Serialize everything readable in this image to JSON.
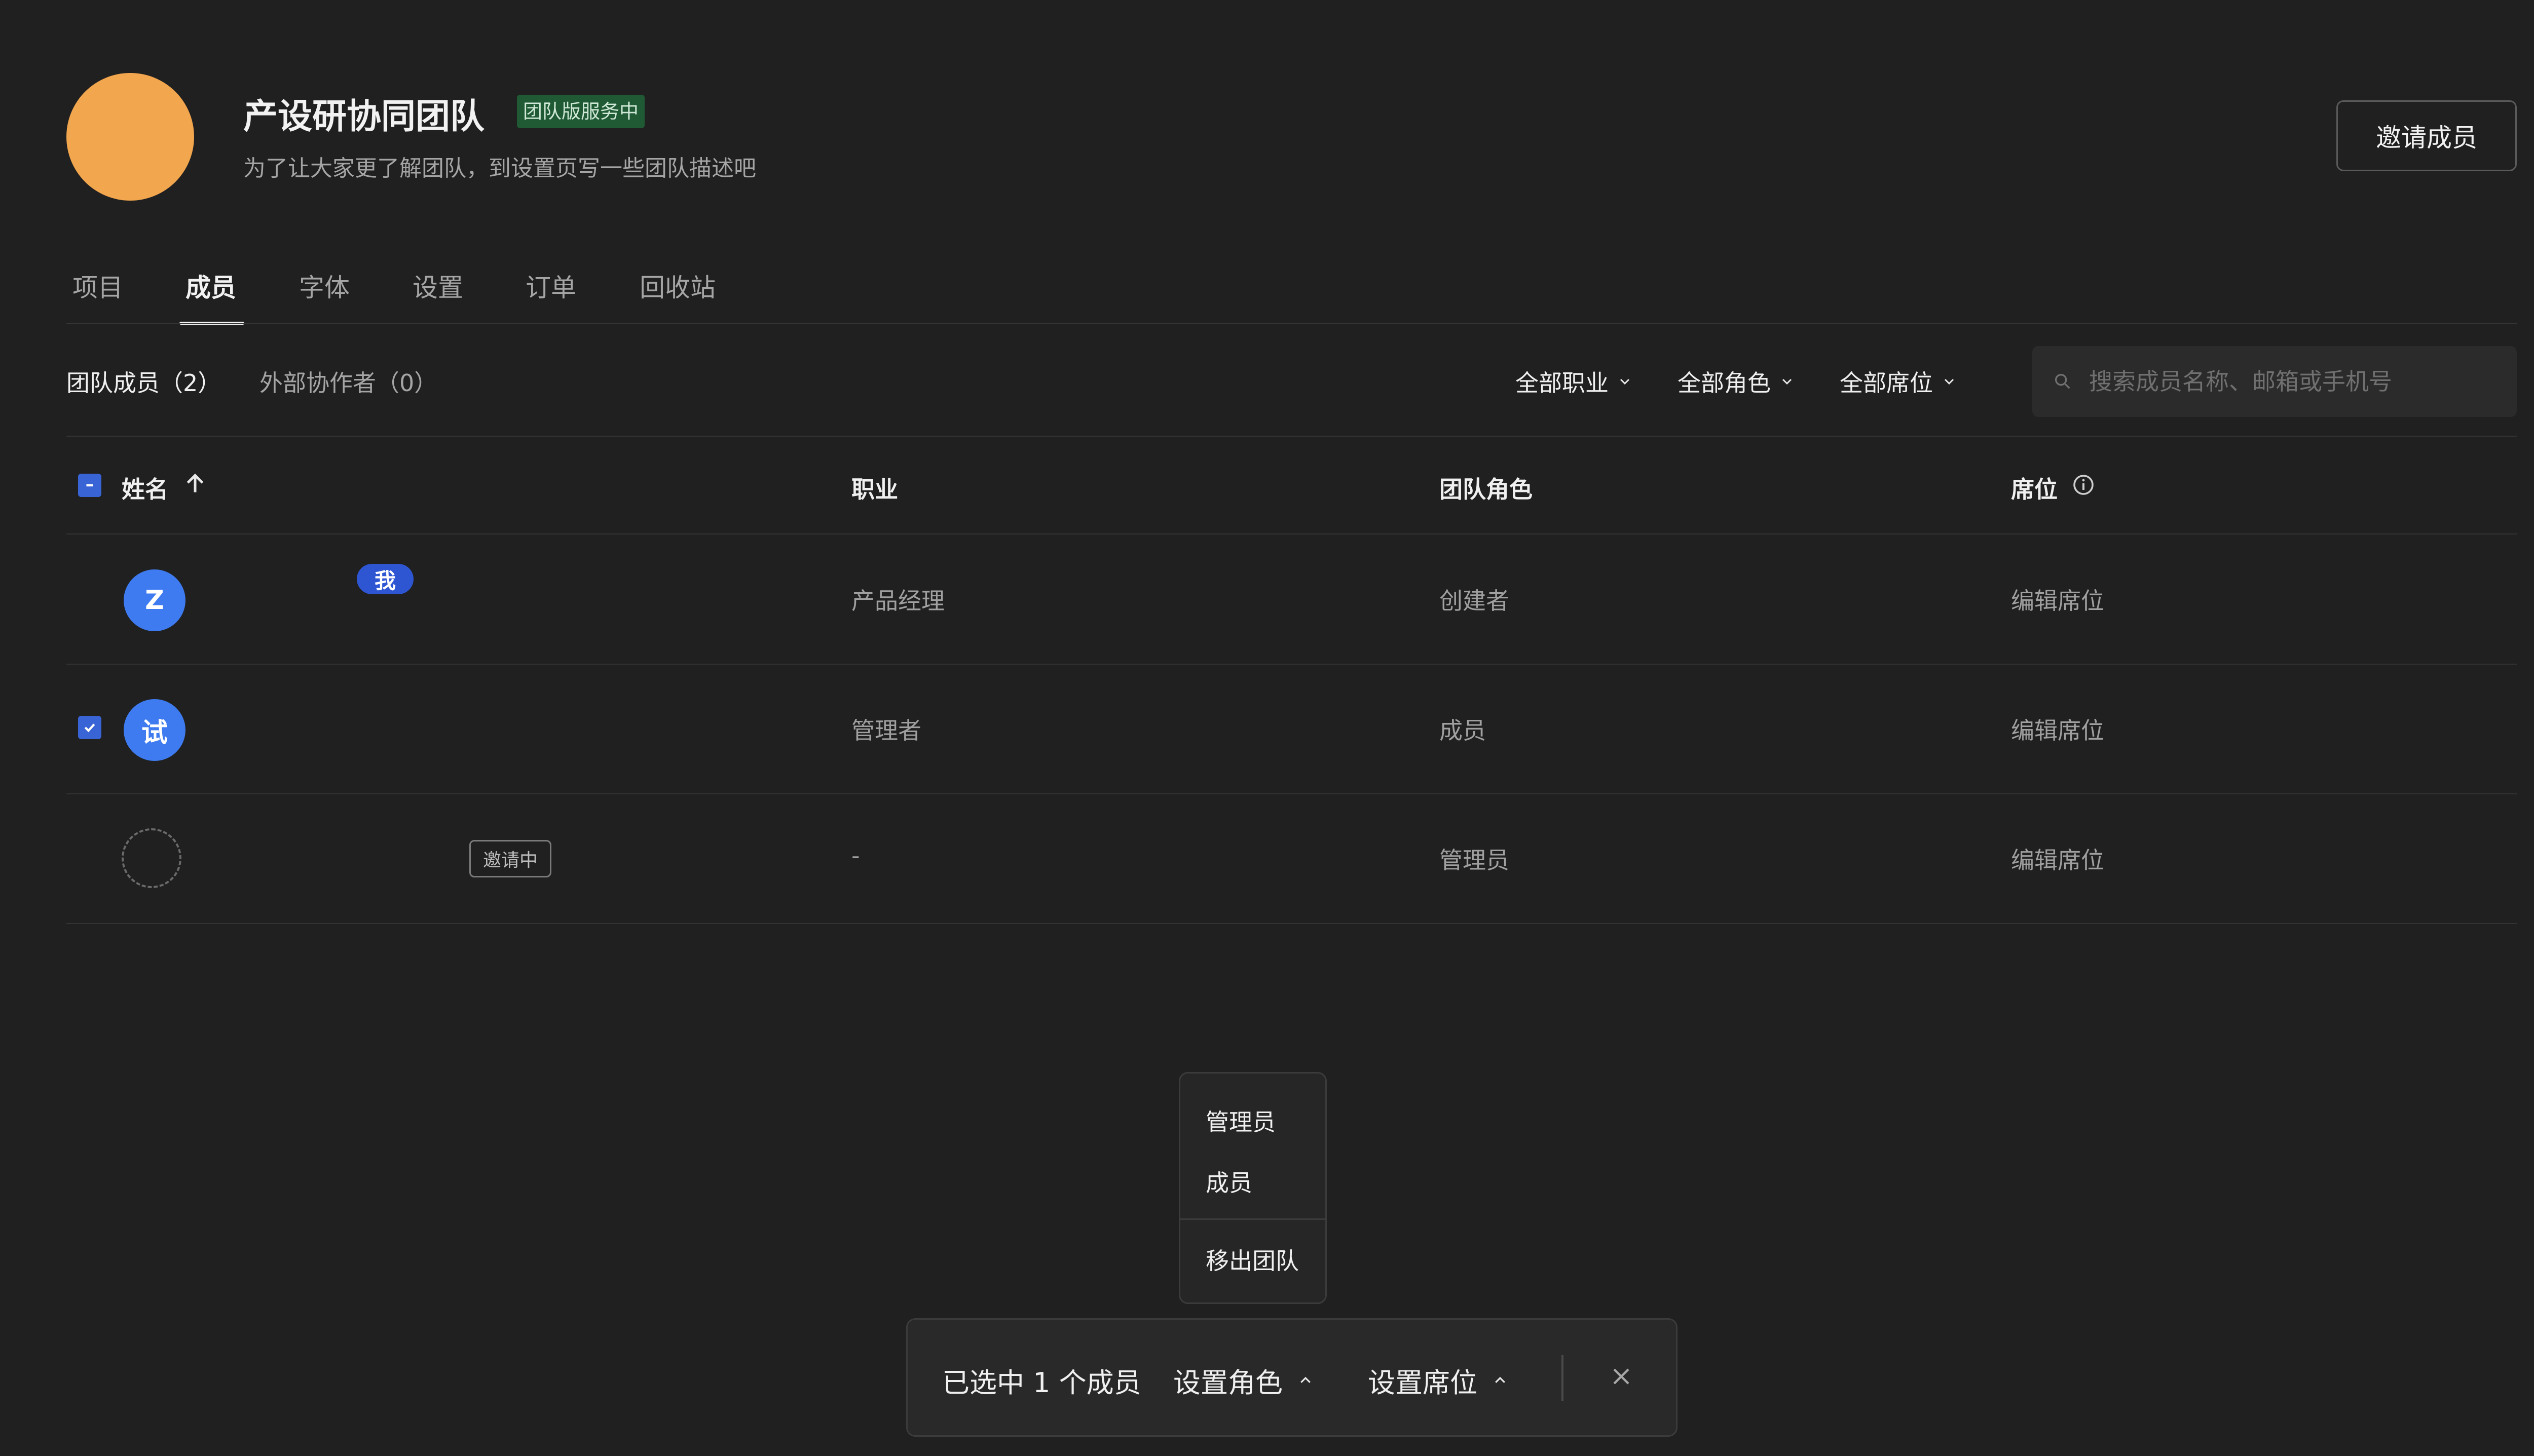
{
  "team": {
    "name": "产设研协同团队",
    "service_badge": "团队版服务中",
    "description": "为了让大家更了解团队，到设置页写一些团队描述吧",
    "invite_button": "邀请成员"
  },
  "tabs": [
    {
      "label": "项目",
      "active": false
    },
    {
      "label": "成员",
      "active": true
    },
    {
      "label": "字体",
      "active": false
    },
    {
      "label": "设置",
      "active": false
    },
    {
      "label": "订单",
      "active": false
    },
    {
      "label": "回收站",
      "active": false
    }
  ],
  "subtabs": {
    "members": "团队成员（2）",
    "external": "外部协作者（0）"
  },
  "filters": {
    "profession": "全部职业",
    "role": "全部角色",
    "seat": "全部席位"
  },
  "search": {
    "placeholder": "搜索成员名称、邮箱或手机号"
  },
  "table": {
    "headers": {
      "name": "姓名",
      "profession": "职业",
      "role": "团队角色",
      "seat": "席位"
    },
    "rows": [
      {
        "avatar": "Z",
        "me_badge": "我",
        "profession": "产品经理",
        "role": "创建者",
        "seat": "编辑席位",
        "checked": false
      },
      {
        "avatar": "试",
        "profession": "管理者",
        "role": "成员",
        "seat": "编辑席位",
        "checked": true
      },
      {
        "avatar": "",
        "status_badge": "邀请中",
        "profession": "-",
        "role": "管理员",
        "seat": "编辑席位",
        "checked": false
      }
    ]
  },
  "role_dropdown": {
    "items": [
      "管理员",
      "成员"
    ],
    "remove": "移出团队"
  },
  "action_bar": {
    "selected_text": "已选中 1 个成员",
    "set_role": "设置角色",
    "set_seat": "设置席位"
  },
  "colors": {
    "background": "#202020",
    "accent": "#3e7bf0",
    "team_avatar": "#f2a64e",
    "badge_green": "#1f5a34"
  }
}
